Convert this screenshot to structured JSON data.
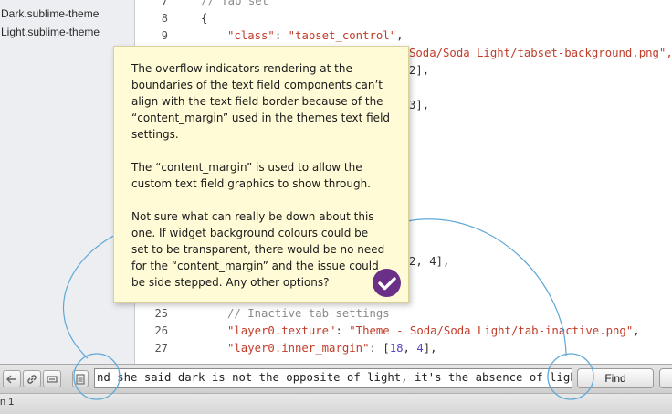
{
  "sidebar": {
    "items": [
      {
        "label": "Dark.sublime-theme"
      },
      {
        "label": "Light.sublime-theme"
      }
    ]
  },
  "editor": {
    "line_numbers": [
      "7",
      "8",
      "9",
      "25",
      "26",
      "27"
    ],
    "lines": {
      "l7": "// Tab set",
      "l8": "{",
      "l9_key": "\"class\"",
      "l9_val": "\"tabset_control\"",
      "frag_a": "Soda/Soda Light/tabset-background.png\",",
      "frag_b": "2],",
      "frag_c": "3],",
      "frag_d": "2, 4],",
      "l25": "// Inactive tab settings",
      "l26_key": "\"layer0.texture\"",
      "l26_val": "\"Theme - Soda/Soda Light/tab-inactive.png\"",
      "l27_key": "\"layer0.inner_margin\"",
      "l27_n1": "18",
      "l27_n2": "4"
    }
  },
  "note": {
    "paragraphs": [
      "The overflow indicators rendering at the boundaries of the text field components can’t align with the text field border because of the “content_margin” used in the themes text field settings.",
      "The “content_margin” is used to allow the custom text field graphics to show through.",
      "Not sure what can really be down about this one. If widget background colours could be set to be transparent, there would be no need for the “content_margin” and the issue could be side stepped. Any other options?"
    ]
  },
  "findbar": {
    "query": "nd she said dark is not the opposite of light, it's the absence of light",
    "find_label": "Find"
  },
  "statusbar": {
    "text": "n 1"
  },
  "colors": {
    "note_bg": "#fffbd6",
    "badge": "#6a2f86",
    "annotation": "#5fa8d6",
    "string": "#c23c2a",
    "number": "#5d3fc4"
  }
}
